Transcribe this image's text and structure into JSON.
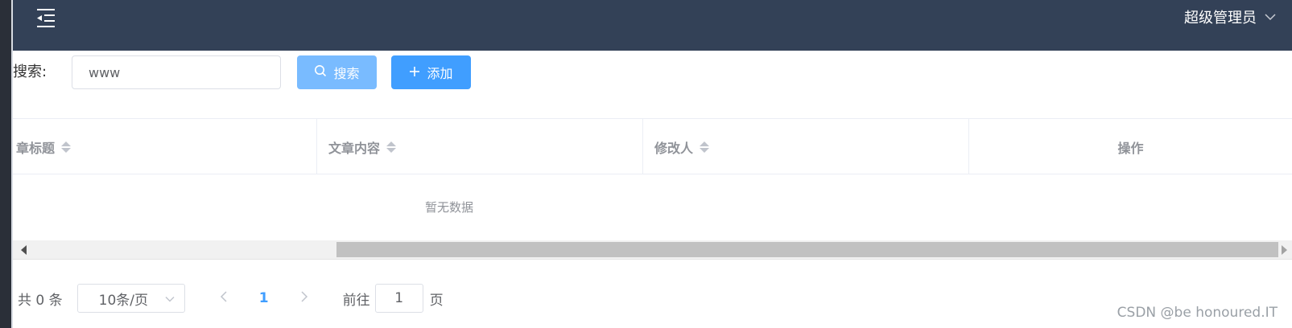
{
  "header": {
    "menu_toggle_icon": "menu-fold-icon",
    "user_name": "超级管理员",
    "user_dropdown_icon": "chevron-down-icon",
    "background_color": "#334157"
  },
  "toolbar": {
    "search_label": "搜索:",
    "search_value": "www",
    "search_button_label": "搜索",
    "search_button_icon": "search-icon",
    "add_button_label": "添加",
    "add_button_icon": "plus-icon",
    "search_button_color": "#79bbff",
    "add_button_color": "#409eff"
  },
  "table": {
    "columns": [
      {
        "label": "章标题",
        "sortable": true
      },
      {
        "label": "文章内容",
        "sortable": true
      },
      {
        "label": "修改人",
        "sortable": true
      },
      {
        "label": "操作",
        "sortable": false
      }
    ],
    "empty_text": "暂无数据",
    "rows": []
  },
  "pagination": {
    "total_text": "共 0 条",
    "page_size": "10条/页",
    "current_page": "1",
    "goto_label": "前往",
    "goto_value": "1",
    "page_suffix": "页",
    "accent_color": "#409eff"
  },
  "watermark": "CSDN @be honoured.IT"
}
